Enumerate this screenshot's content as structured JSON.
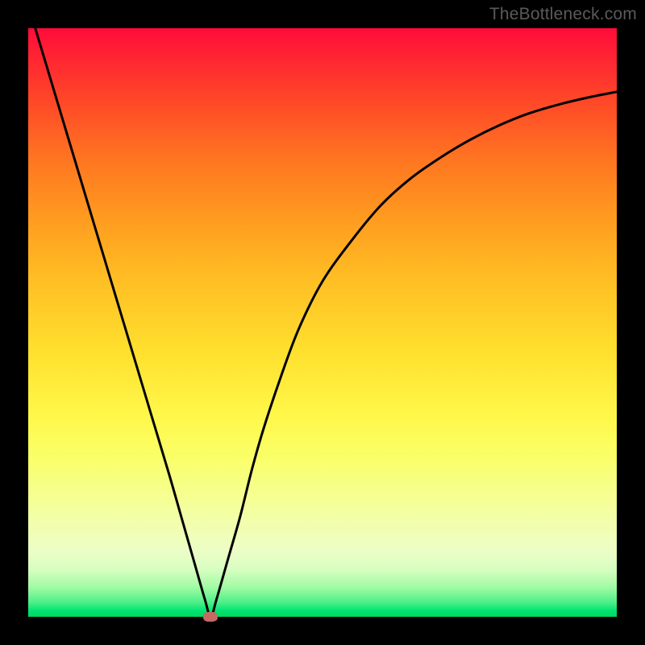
{
  "watermark": "TheBottleneck.com",
  "colors": {
    "frame": "#000000",
    "gradient_top": "#ff0b3a",
    "gradient_bottom": "#00d860",
    "curve": "#000000",
    "minpoint": "#c46a63"
  },
  "chart_data": {
    "type": "line",
    "title": "",
    "xlabel": "",
    "ylabel": "",
    "xlim": [
      0,
      100
    ],
    "ylim": [
      0,
      100
    ],
    "grid": false,
    "series": [
      {
        "name": "bottleneck-curve",
        "x": [
          0,
          3,
          6,
          9,
          12,
          15,
          18,
          21,
          24,
          26,
          28,
          30,
          31,
          32,
          34,
          36,
          38,
          40,
          43,
          46,
          50,
          55,
          60,
          65,
          70,
          75,
          80,
          85,
          90,
          95,
          100
        ],
        "values": [
          104,
          94,
          84,
          74,
          64,
          54,
          44,
          34,
          24,
          17,
          10,
          3,
          0,
          3,
          10,
          17,
          25,
          32,
          41,
          49,
          57,
          64,
          70,
          74.5,
          78,
          81,
          83.5,
          85.5,
          87,
          88.2,
          89.2
        ]
      }
    ],
    "annotations": [
      {
        "name": "minimum-point",
        "x": 31,
        "y": 0
      }
    ]
  }
}
